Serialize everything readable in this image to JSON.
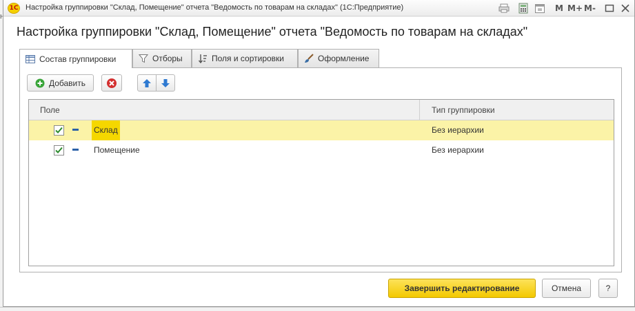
{
  "window": {
    "title": "Настройка группировки \"Склад, Помещение\" отчета \"Ведомость по товарам на складах\"  (1С:Предприятие)",
    "logo_text": "1С",
    "mem_buttons": [
      "M",
      "M+",
      "M-"
    ],
    "behind_letter": "н"
  },
  "dialog": {
    "title": "Настройка группировки \"Склад, Помещение\" отчета \"Ведомость по товарам на складах\""
  },
  "tabs": [
    {
      "label": "Состав группировки",
      "icon": "table-icon",
      "active": true
    },
    {
      "label": "Отборы",
      "icon": "filter-icon",
      "active": false
    },
    {
      "label": "Поля и сортировки",
      "icon": "sort-icon",
      "active": false
    },
    {
      "label": "Оформление",
      "icon": "brush-icon",
      "active": false
    }
  ],
  "toolbar": {
    "add_label": "Добавить",
    "add_icon": "plus-circle-icon",
    "delete_icon": "delete-icon",
    "move_up_icon": "arrow-up-icon",
    "move_down_icon": "arrow-down-icon"
  },
  "table": {
    "columns": [
      "Поле",
      "Тип группировки"
    ],
    "rows": [
      {
        "checked": true,
        "field": "Склад",
        "grouping_type": "Без иерархии",
        "selected": true
      },
      {
        "checked": true,
        "field": "Помещение",
        "grouping_type": "Без иерархии",
        "selected": false
      }
    ]
  },
  "footer": {
    "finish_label": "Завершить редактирование",
    "cancel_label": "Отмена",
    "help_label": "?"
  },
  "colors": {
    "accent_yellow": "#f5d700",
    "row_highlight": "#fbf3a7",
    "check_green": "#2e8b2e",
    "arrow_blue": "#2f7ad1",
    "delete_red": "#d32f2f"
  }
}
